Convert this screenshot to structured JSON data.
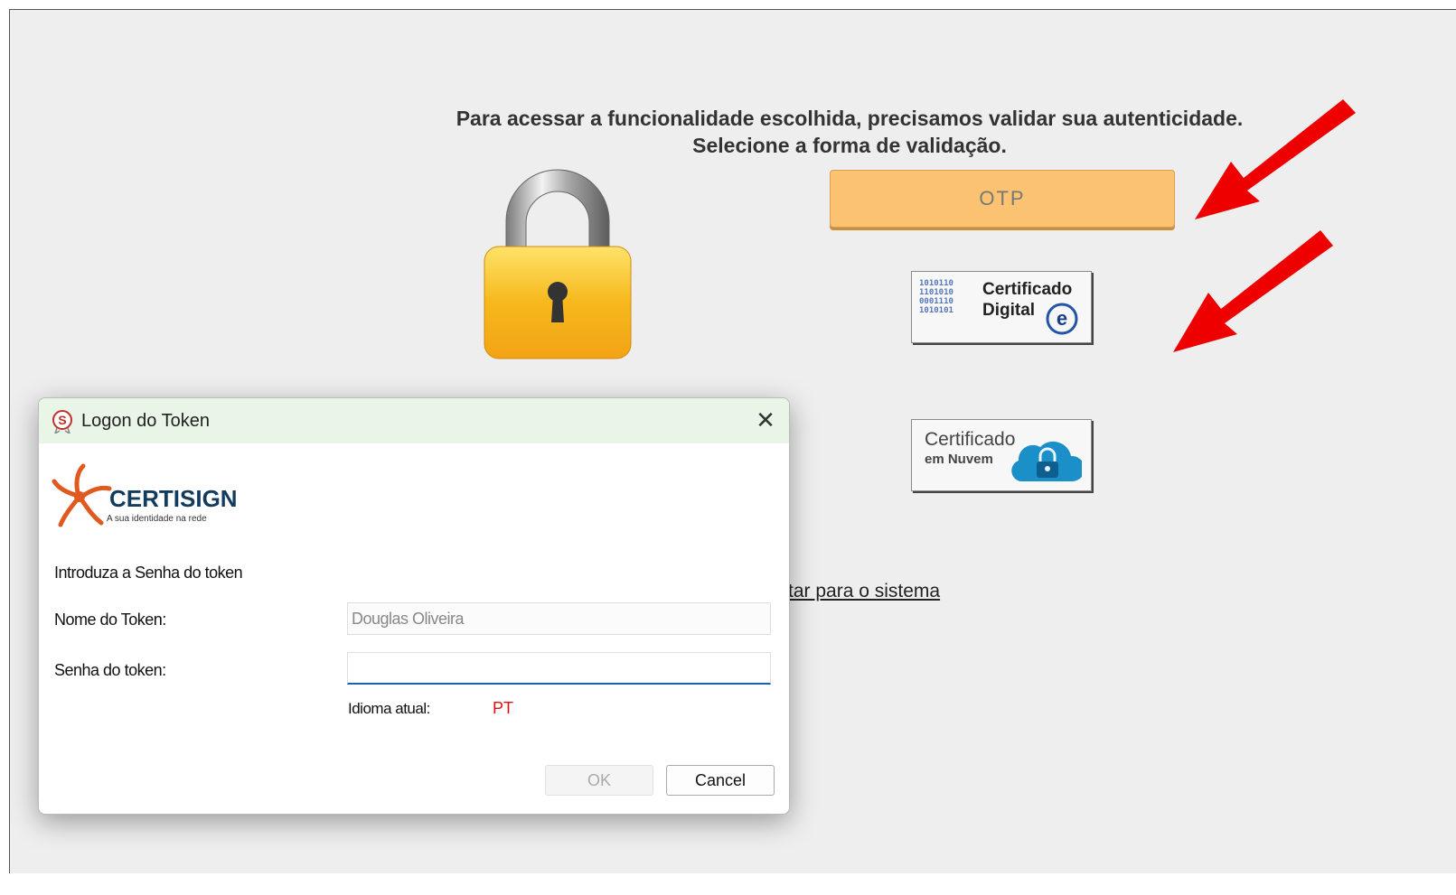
{
  "page": {
    "heading_line1": "Para acessar a funcionalidade escolhida, precisamos validar sua autenticidade.",
    "heading_line2": "Selecione a forma de validação.",
    "otp_label": "OTP",
    "cert_digital": {
      "line1": "Certificado",
      "line2": "Digital",
      "icon": "e-cpf-icon"
    },
    "cert_nuvem": {
      "line1": "Certificado",
      "line2": "em Nuvem",
      "icon": "cloud-lock-icon"
    },
    "back_link": "tar para o sistema"
  },
  "dialog": {
    "title": "Logon do Token",
    "close_icon": "close-icon",
    "logo_text": "CERTISIGN",
    "logo_tagline": "A sua identidade na rede",
    "intro": "Introduza a Senha do token",
    "nome_label": "Nome do Token:",
    "nome_value": "Douglas Oliveira",
    "senha_label": "Senha do token:",
    "senha_value": "",
    "idioma_label": "Idioma atual:",
    "idioma_value": "PT",
    "ok_label": "OK",
    "cancel_label": "Cancel"
  },
  "colors": {
    "otp_button": "#fbc271",
    "dialog_titlebar": "#e9f5e6",
    "annotation_arrow": "#ee0000",
    "idioma_value": "#e01010"
  }
}
